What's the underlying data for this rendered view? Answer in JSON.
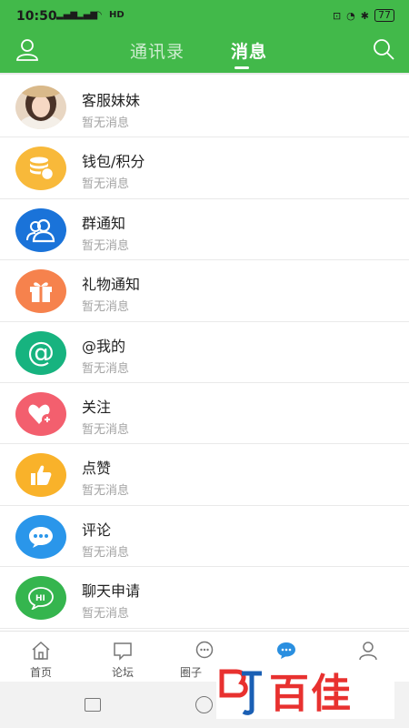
{
  "status": {
    "time": "10:50",
    "signal1": "5G",
    "signal2": "4G",
    "battery": "77"
  },
  "header": {
    "tabs": [
      {
        "label": "通讯录",
        "active": false
      },
      {
        "label": "消息",
        "active": true
      }
    ],
    "left_icon": "user-icon",
    "right_icon": "search-icon",
    "color": "#42b94a"
  },
  "messages": [
    {
      "title": "客服妹妹",
      "sub": "暂无消息",
      "icon": "avatar-photo",
      "color": "#e8c9a8"
    },
    {
      "title": "钱包/积分",
      "sub": "暂无消息",
      "icon": "coins-icon",
      "color": "#f8b93a"
    },
    {
      "title": "群通知",
      "sub": "暂无消息",
      "icon": "group-icon",
      "color": "#1a73d9"
    },
    {
      "title": "礼物通知",
      "sub": "暂无消息",
      "icon": "gift-icon",
      "color": "#f6824d"
    },
    {
      "title": "@我的",
      "sub": "暂无消息",
      "icon": "at-icon",
      "color": "#17b37f"
    },
    {
      "title": "关注",
      "sub": "暂无消息",
      "icon": "heart-plus-icon",
      "color": "#f35f6e"
    },
    {
      "title": "点赞",
      "sub": "暂无消息",
      "icon": "thumbs-up-icon",
      "color": "#f9b22a"
    },
    {
      "title": "评论",
      "sub": "暂无消息",
      "icon": "comment-icon",
      "color": "#2a96ea"
    },
    {
      "title": "聊天申请",
      "sub": "暂无消息",
      "icon": "hi-bubble-icon",
      "color": "#35b54e"
    }
  ],
  "bottom_nav": [
    {
      "label": "首页",
      "icon": "home-icon",
      "active": false
    },
    {
      "label": "论坛",
      "icon": "forum-icon",
      "active": false
    },
    {
      "label": "圈子",
      "icon": "circle-chat-icon",
      "active": false
    },
    {
      "label": "",
      "icon": "message-icon",
      "active": true
    },
    {
      "label": "",
      "icon": "profile-icon",
      "active": false
    }
  ],
  "watermark": {
    "text": "百佳"
  }
}
